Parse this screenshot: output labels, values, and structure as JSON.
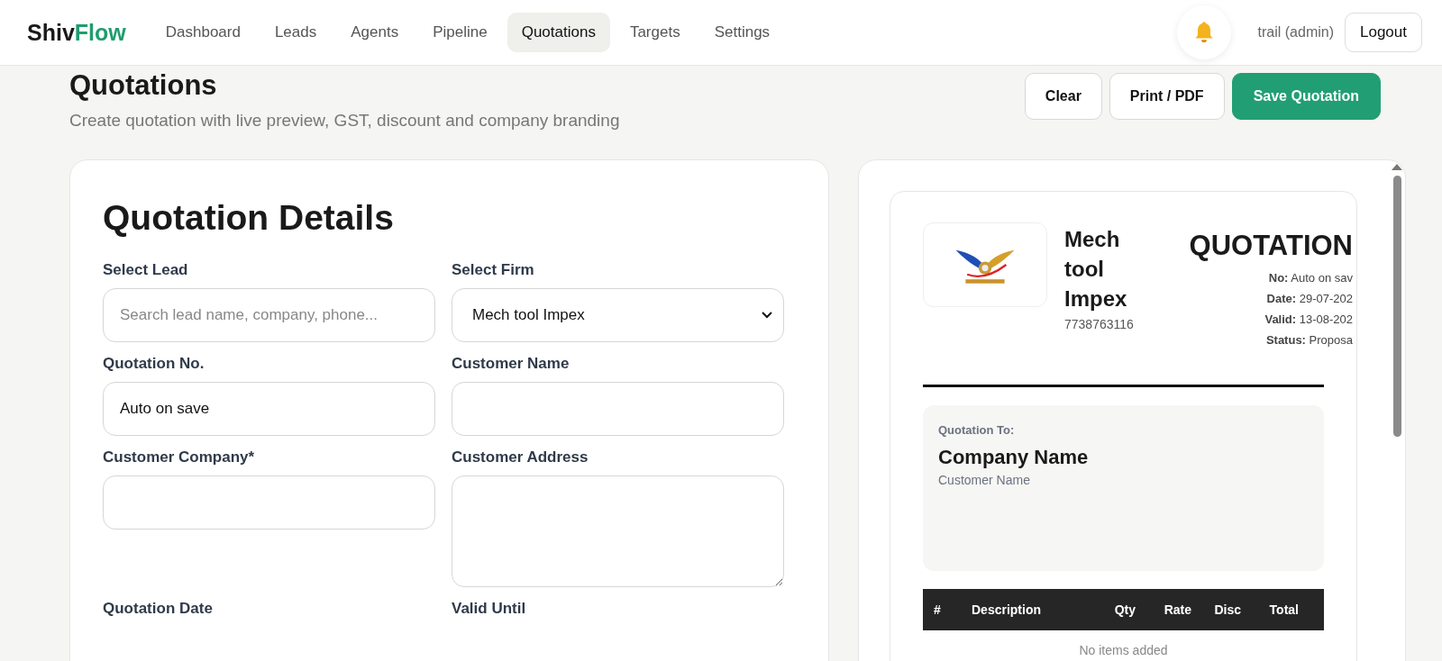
{
  "brand": {
    "part_1": "Shiv",
    "part_2": "Flow"
  },
  "nav": [
    {
      "label": "Dashboard",
      "selected": false
    },
    {
      "label": "Leads",
      "selected": false
    },
    {
      "label": "Agents",
      "selected": false
    },
    {
      "label": "Pipeline",
      "selected": false
    },
    {
      "label": "Quotations",
      "selected": true
    },
    {
      "label": "Targets",
      "selected": false
    },
    {
      "label": "Settings",
      "selected": false
    }
  ],
  "user": "trail (admin)",
  "logout": "Logout",
  "page": {
    "title": "Quotations",
    "subtitle": "Create quotation with live preview, GST, discount and company branding"
  },
  "actions": [
    {
      "label": "Clear",
      "kind": "secondary"
    },
    {
      "label": "Print / PDF",
      "kind": "secondary"
    },
    {
      "label": "Save Quotation",
      "kind": "primary"
    }
  ],
  "form": {
    "title": "Quotation Details",
    "fields": [
      {
        "label": "Select Lead",
        "kind": "input",
        "placeholder": "Search lead name, company, phone..."
      },
      {
        "label": "Select Firm",
        "kind": "select",
        "value": "Mech tool Impex"
      },
      {
        "label": "Quotation No.",
        "kind": "input",
        "value": "Auto on save"
      },
      {
        "label": "Customer Name",
        "kind": "input"
      },
      {
        "label": "Customer Company*",
        "kind": "input"
      },
      {
        "label": "Customer Address",
        "kind": "textarea"
      },
      {
        "label": "Quotation Date",
        "kind": "label"
      },
      {
        "label": "Valid Until",
        "kind": "label"
      }
    ]
  },
  "preview": {
    "company_lines": [
      "Mech",
      "tool",
      "Impex"
    ],
    "phone": "7738763116",
    "doc_title": "QUOTATION",
    "meta": [
      {
        "key": "No:",
        "value": "Auto on sav"
      },
      {
        "key": "Date:",
        "value": "29-07-202"
      },
      {
        "key": "Valid:",
        "value": "13-08-202"
      },
      {
        "key": "Status:",
        "value": "Proposa"
      }
    ],
    "to_label": "Quotation To:",
    "to_company": "Company Name",
    "to_customer": "Customer Name",
    "columns": [
      "#",
      "Description",
      "Qty",
      "Rate",
      "Disc",
      "Total"
    ],
    "empty": "No items added"
  }
}
